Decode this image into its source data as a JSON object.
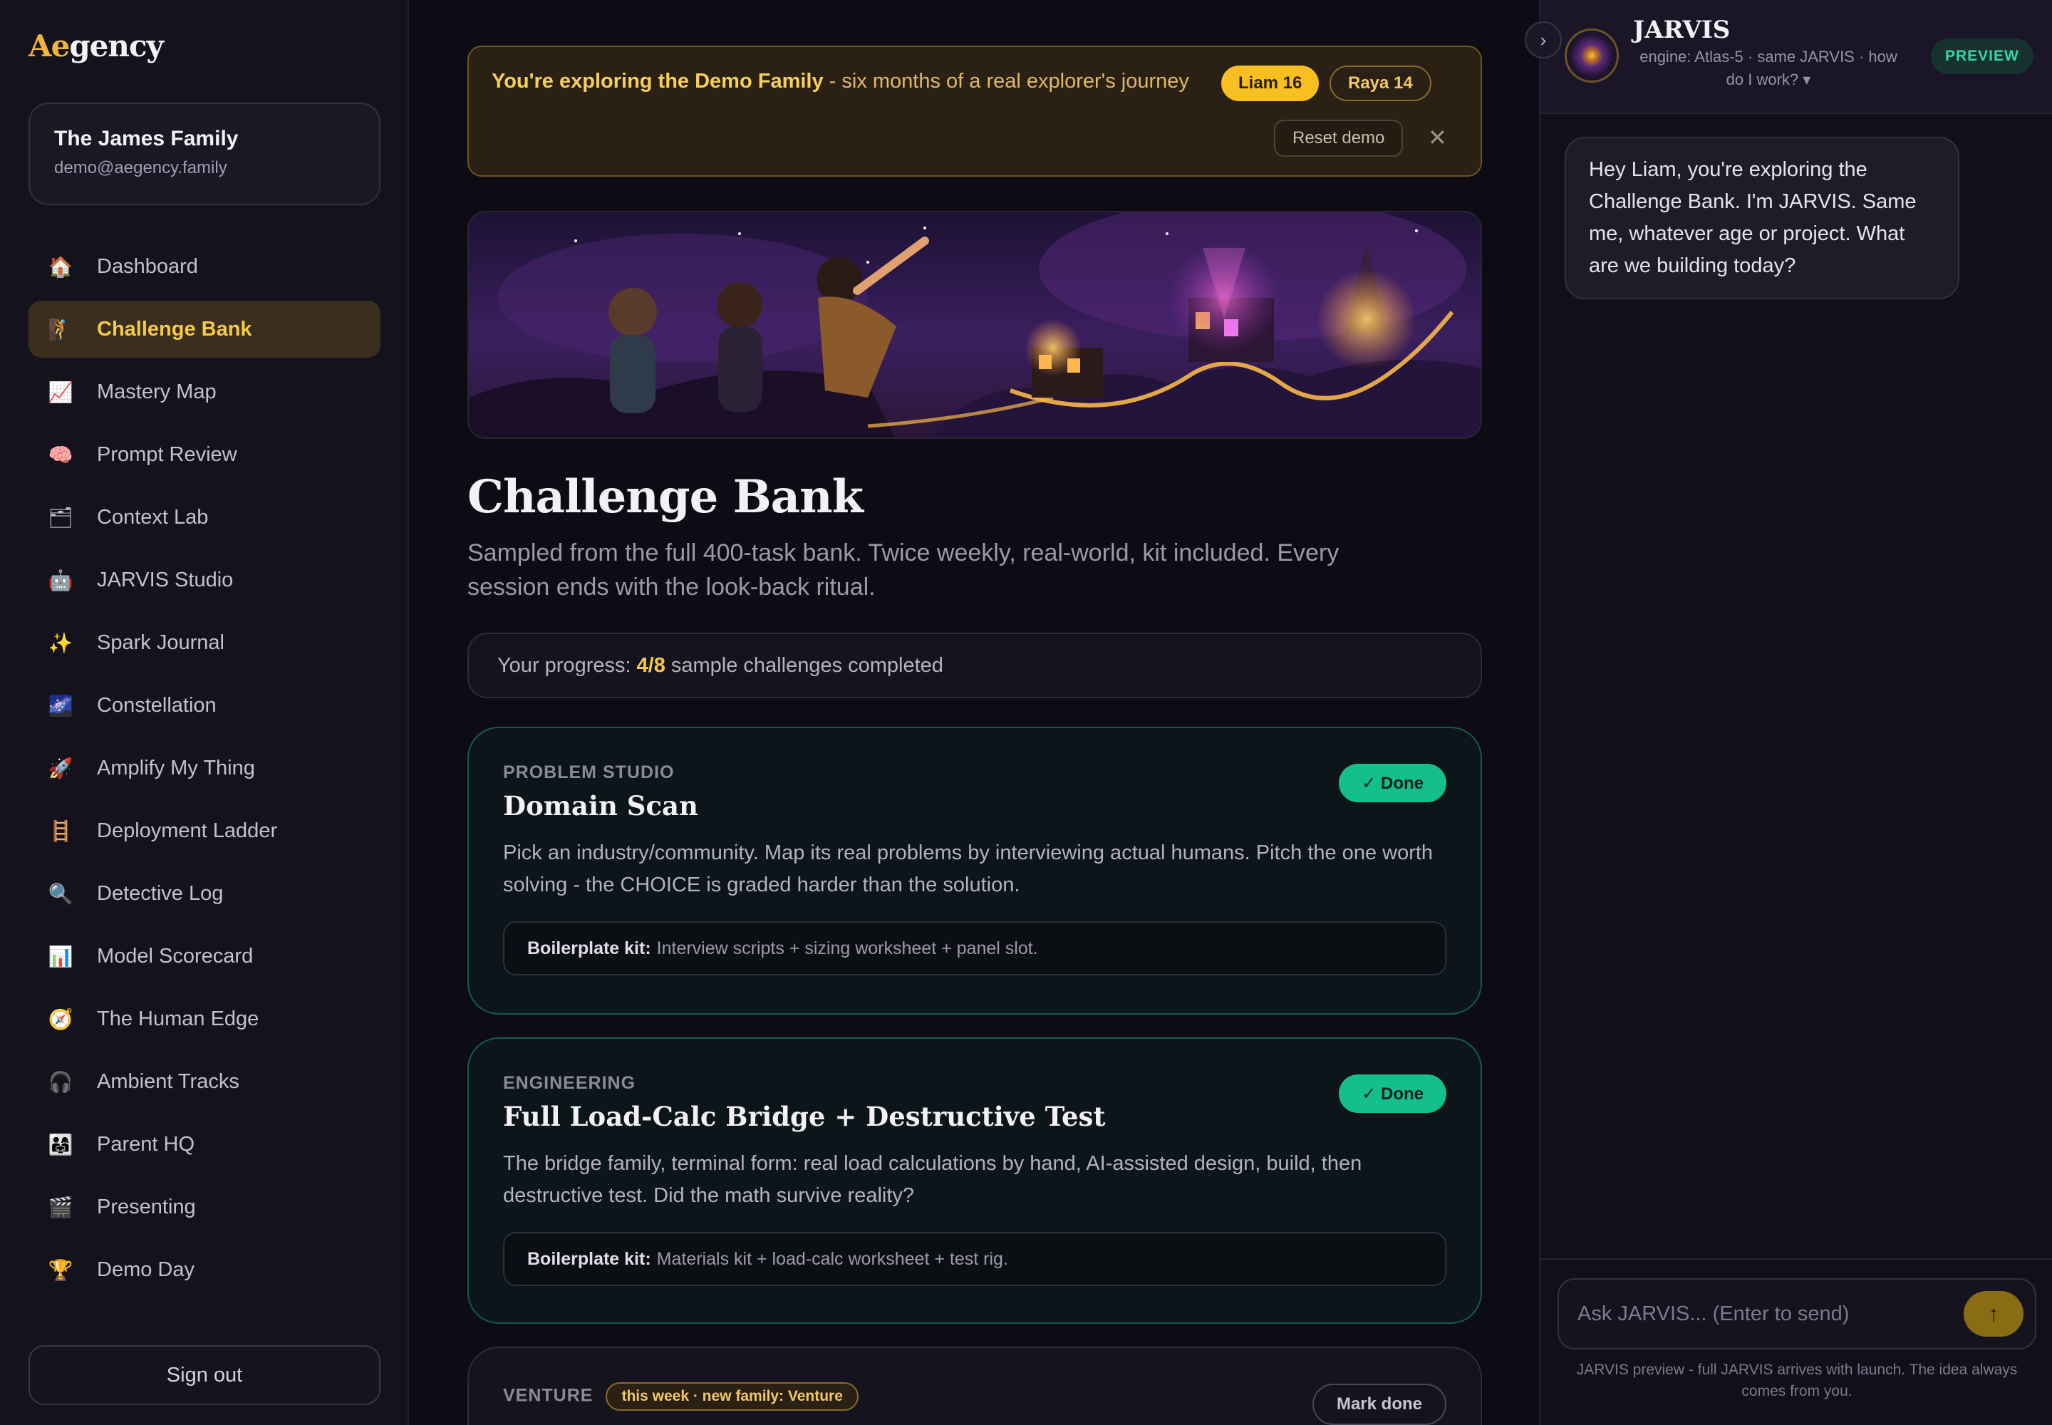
{
  "logo": {
    "ae": "Ae",
    "rest": "gency"
  },
  "family": {
    "name": "The James Family",
    "email": "demo@aegency.family"
  },
  "nav": [
    {
      "label": "Dashboard",
      "icon": "house-icon",
      "glyph": "🏠"
    },
    {
      "label": "Challenge Bank",
      "icon": "climber-icon",
      "glyph": "🧗",
      "active": true
    },
    {
      "label": "Mastery Map",
      "icon": "chart-up-icon",
      "glyph": "📈"
    },
    {
      "label": "Prompt Review",
      "icon": "brain-icon",
      "glyph": "🧠"
    },
    {
      "label": "Context Lab",
      "icon": "folder-icon",
      "glyph": "🗂"
    },
    {
      "label": "JARVIS Studio",
      "icon": "robot-icon",
      "glyph": "🤖"
    },
    {
      "label": "Spark Journal",
      "icon": "sparkles-icon",
      "glyph": "✨"
    },
    {
      "label": "Constellation",
      "icon": "galaxy-icon",
      "glyph": "🌌"
    },
    {
      "label": "Amplify My Thing",
      "icon": "rocket-icon",
      "glyph": "🚀"
    },
    {
      "label": "Deployment Ladder",
      "icon": "ladder-icon",
      "glyph": "🪜"
    },
    {
      "label": "Detective Log",
      "icon": "magnifier-icon",
      "glyph": "🔍"
    },
    {
      "label": "Model Scorecard",
      "icon": "bar-chart-icon",
      "glyph": "📊"
    },
    {
      "label": "The Human Edge",
      "icon": "compass-icon",
      "glyph": "🧭"
    },
    {
      "label": "Ambient Tracks",
      "icon": "headphones-icon",
      "glyph": "🎧"
    },
    {
      "label": "Parent HQ",
      "icon": "family-icon",
      "glyph": "👨‍👩‍👧"
    },
    {
      "label": "Presenting",
      "icon": "clapper-icon",
      "glyph": "🎬"
    },
    {
      "label": "Demo Day",
      "icon": "trophy-icon",
      "glyph": "🏆"
    }
  ],
  "signout": "Sign out",
  "banner": {
    "bold": "You're exploring the Demo Family",
    "rest": " - six months of a real explorer's journey",
    "chip_liam": "Liam 16",
    "chip_raya": "Raya 14",
    "reset": "Reset demo",
    "close": "✕"
  },
  "page": {
    "title": "Challenge Bank",
    "subtitle": "Sampled from the full 400-task bank. Twice weekly, real-world, kit included. Every session ends with the look-back ritual.",
    "progress_prefix": "Your progress:",
    "progress_value": "4/8",
    "progress_suffix": "sample challenges completed"
  },
  "cards": [
    {
      "category": "PROBLEM STUDIO",
      "title": "Domain Scan",
      "desc": "Pick an industry/community. Map its real problems by interviewing actual humans. Pitch the one worth solving - the CHOICE is graded harder than the solution.",
      "kit_label": "Boilerplate kit:",
      "kit": "Interview scripts + sizing worksheet + panel slot.",
      "status": "✓ Done"
    },
    {
      "category": "ENGINEERING",
      "title": "Full Load-Calc Bridge + Destructive Test",
      "desc": "The bridge family, terminal form: real load calculations by hand, AI-assisted design, build, then destructive test. Did the math survive reality?",
      "kit_label": "Boilerplate kit:",
      "kit": "Materials kit + load-calc worksheet + test rig.",
      "status": "✓ Done"
    },
    {
      "category": "VENTURE",
      "week_chip": "this week · new family: Venture",
      "action": "Mark done"
    }
  ],
  "jarvis": {
    "name": "JARVIS",
    "engine": "engine: Atlas-5 · same JARVIS · how do I work? ▾",
    "badge": "PREVIEW",
    "collapse": "›",
    "message": "Hey Liam, you're exploring the Challenge Bank. I'm JARVIS. Same me, whatever age or project. What are we building today?",
    "placeholder": "Ask JARVIS... (Enter to send)",
    "send": "↑",
    "note": "JARVIS preview - full JARVIS arrives with launch. The idea always comes from you."
  }
}
